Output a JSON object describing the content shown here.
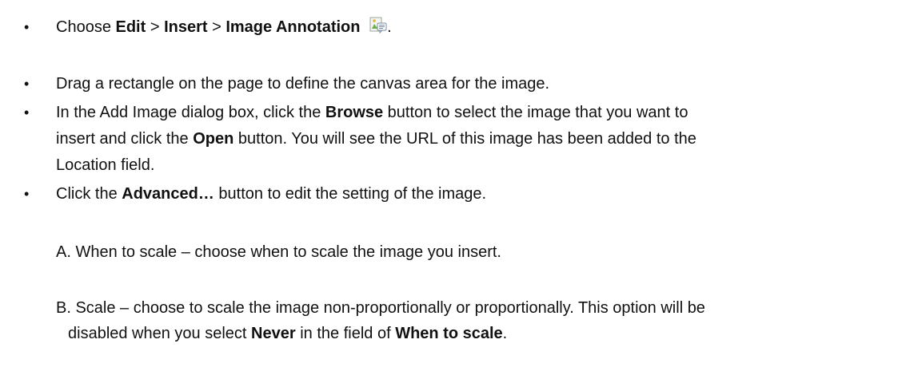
{
  "steps": [
    {
      "bullet": "•",
      "prefix": "Choose ",
      "edit": "Edit",
      "sep1": " > ",
      "insert": "Insert",
      "sep2": " > ",
      "image_annotation": "Image Annotation",
      "icon": "image-annotation-icon",
      "suffix": "."
    },
    {
      "bullet": "•",
      "text": "Drag a rectangle on the page to define the canvas area for the image."
    },
    {
      "bullet": "•",
      "line1_a": "In the Add Image dialog box, click the ",
      "browse": "Browse",
      "line1_b": " button to select the image that you want to",
      "line2_a": "insert and click the ",
      "open": "Open",
      "line2_b": " button. You will see the URL of this image has been added to the",
      "line3": "Location field."
    },
    {
      "bullet": "•",
      "a": "Click the ",
      "advanced": "Advanced…",
      "b": " button to edit the setting of the image."
    }
  ],
  "sub_items": {
    "a": "A. When to scale – choose when to scale the image you insert.",
    "b_line1": "B. Scale – choose to scale the image non-proportionally or proportionally. This option will be",
    "b_line2_a": "disabled when you select ",
    "never": "Never",
    "b_line2_b": " in the field of ",
    "when_to_scale": "When to scale",
    "b_line2_c": "."
  }
}
